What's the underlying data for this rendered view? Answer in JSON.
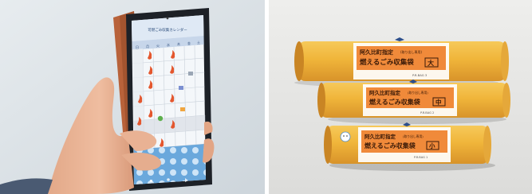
{
  "left_photo": {
    "screen_header": "可燃ごみ収集カレンダー",
    "calendar_weekdays": [
      "日",
      "月",
      "火",
      "水",
      "木",
      "金",
      "土"
    ]
  },
  "right_photo": {
    "bags": [
      {
        "line1": "阿久比町指定",
        "line1_sub": "(取り出し専用)",
        "line2": "燃えるごみ収集袋",
        "size": "大",
        "code": "P.R.BAG 3"
      },
      {
        "line1": "阿久比町指定",
        "line1_sub": "(取り出し専用)",
        "line2": "燃えるごみ収集袋",
        "size": "中",
        "code": "P.R.BAG 2"
      },
      {
        "line1": "阿久比町指定",
        "line1_sub": "(取り出し専用)",
        "line2": "燃えるごみ収集袋",
        "size": "小",
        "code": "P.R.BAG 1"
      }
    ]
  },
  "colors": {
    "bag_yellow": "#f0b53a",
    "label_orange": "#f08a3a",
    "phone_frame": "#1d2127",
    "phone_case": "#b8623a"
  }
}
